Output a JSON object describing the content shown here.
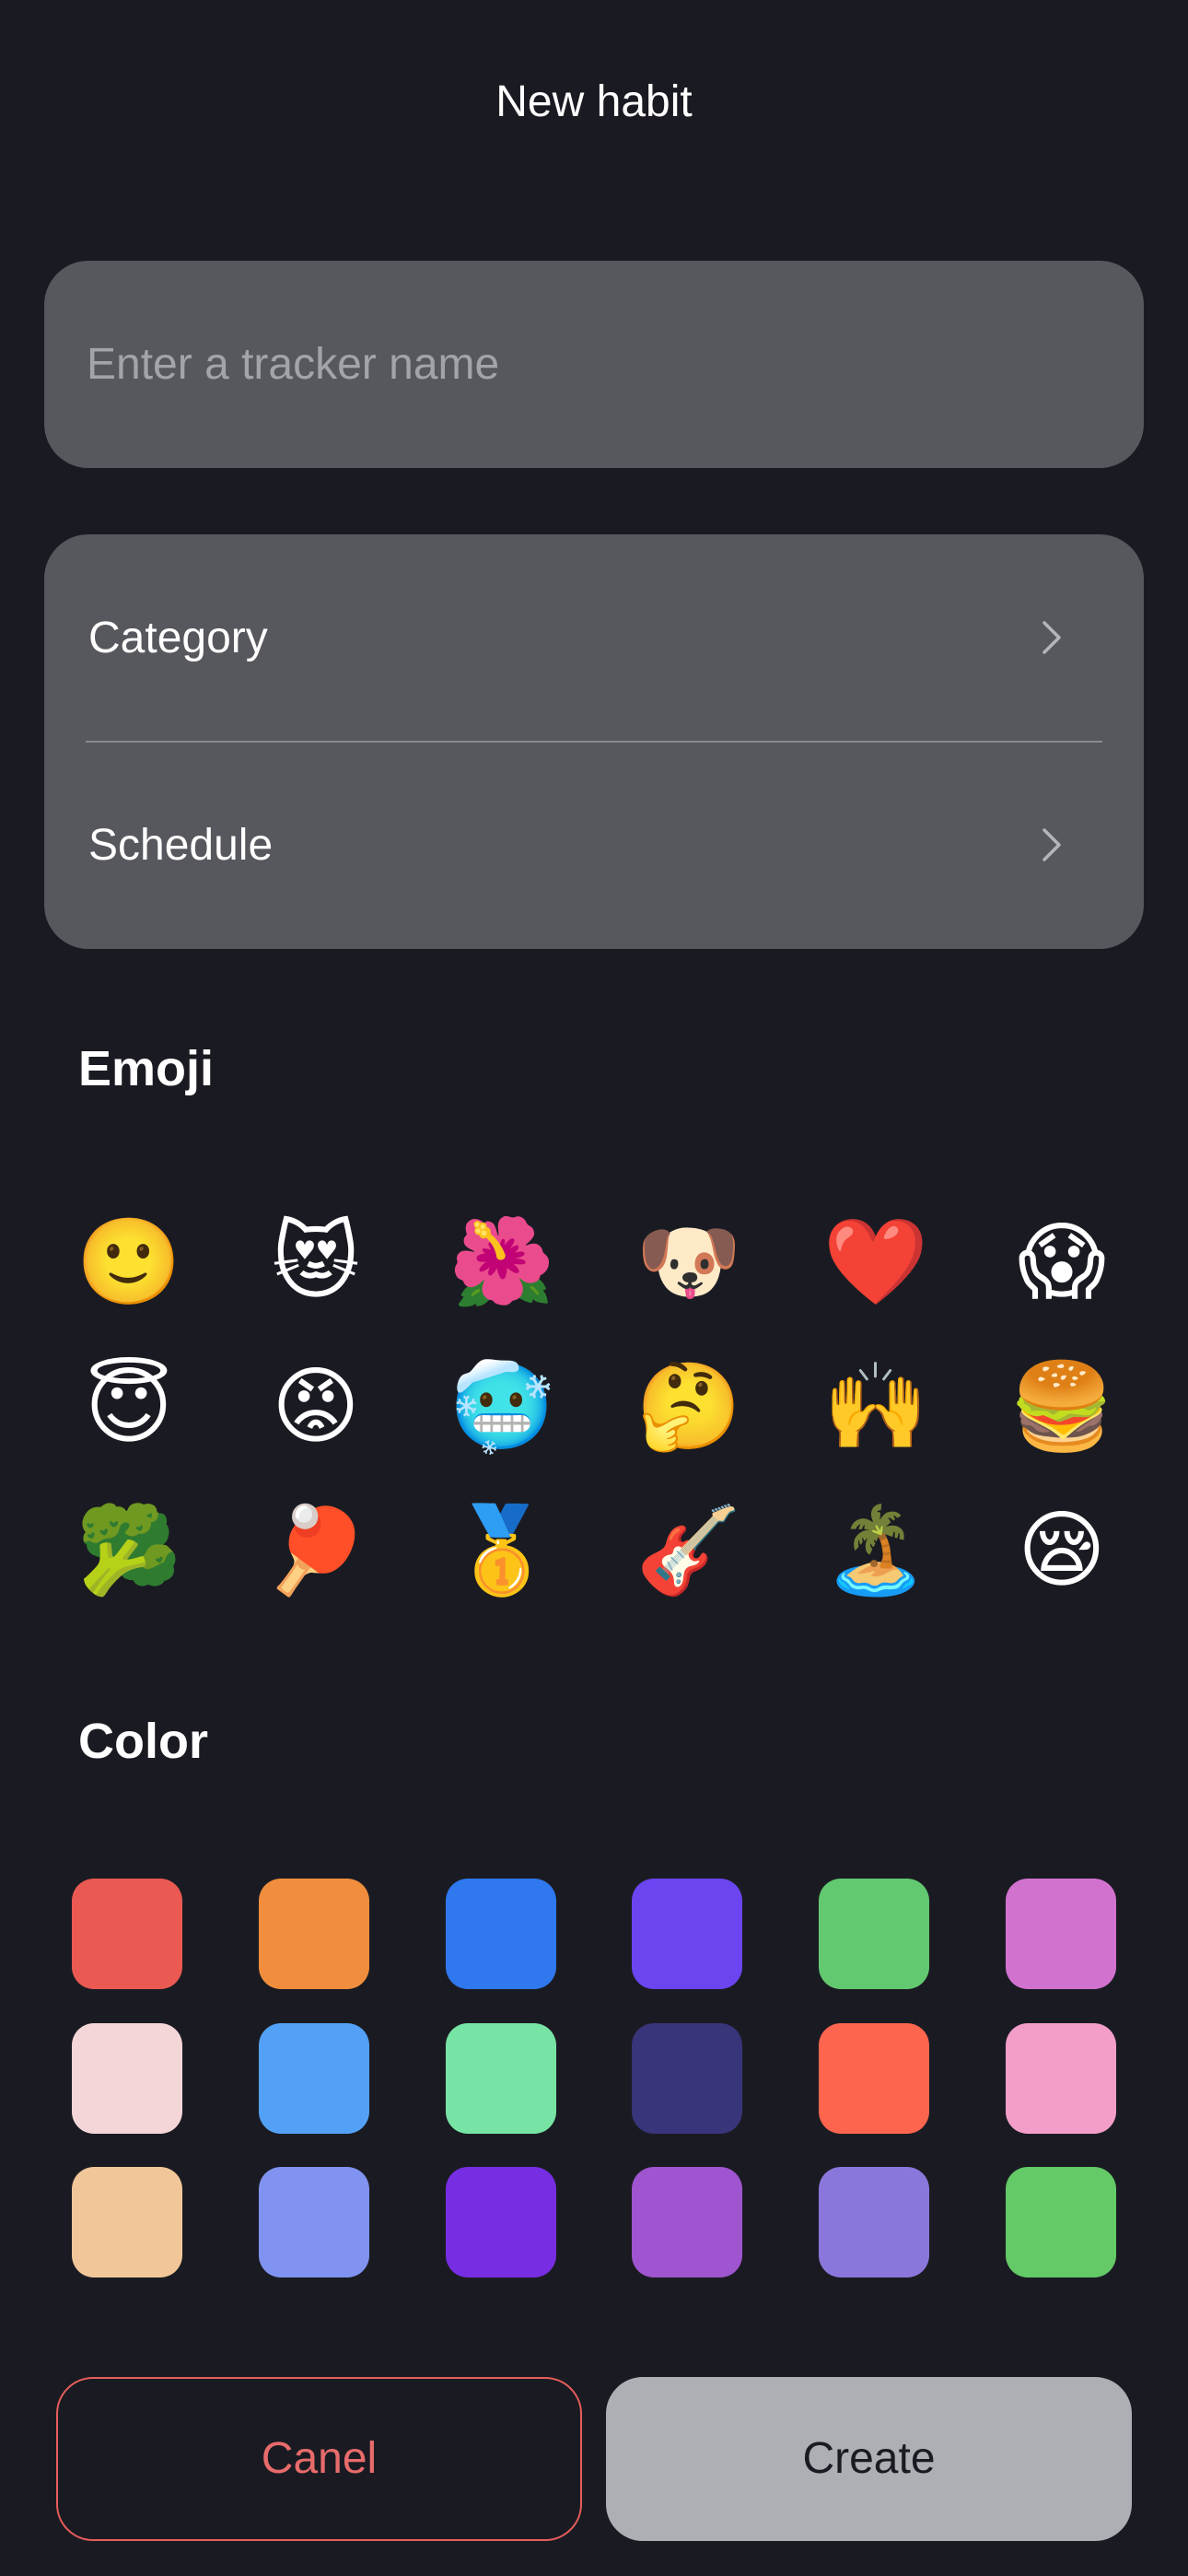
{
  "header": {
    "title": "New habit"
  },
  "name_input": {
    "placeholder": "Enter a tracker name",
    "value": ""
  },
  "options": [
    {
      "label": "Category",
      "icon": "chevron-right-icon"
    },
    {
      "label": "Schedule",
      "icon": "chevron-right-icon"
    }
  ],
  "emoji_section": {
    "title": "Emoji",
    "items": [
      "🙂",
      "😻",
      "🌺",
      "🐶",
      "❤️",
      "😱",
      "😇",
      "😡",
      "🥶",
      "🤔",
      "🙌",
      "🍔",
      "🥦",
      "🏓",
      "🥇",
      "🎸",
      "🏝️",
      "😪"
    ]
  },
  "color_section": {
    "title": "Color",
    "items": [
      "#ea5a52",
      "#f18e3d",
      "#2f78ee",
      "#6a45f0",
      "#63c970",
      "#d272cf",
      "#f5d6d8",
      "#53a1f6",
      "#77e3a4",
      "#38357a",
      "#fd654f",
      "#f29ec9",
      "#f1c799",
      "#8093f0",
      "#772ee2",
      "#a055d0",
      "#8b77dc",
      "#63ca67"
    ]
  },
  "actions": {
    "cancel_label": "Canel",
    "create_label": "Create"
  },
  "theme": {
    "background": "#1a1b22",
    "card": "#57585e",
    "cancel_accent": "#e85d5d",
    "create_button": "#aeafb4"
  }
}
